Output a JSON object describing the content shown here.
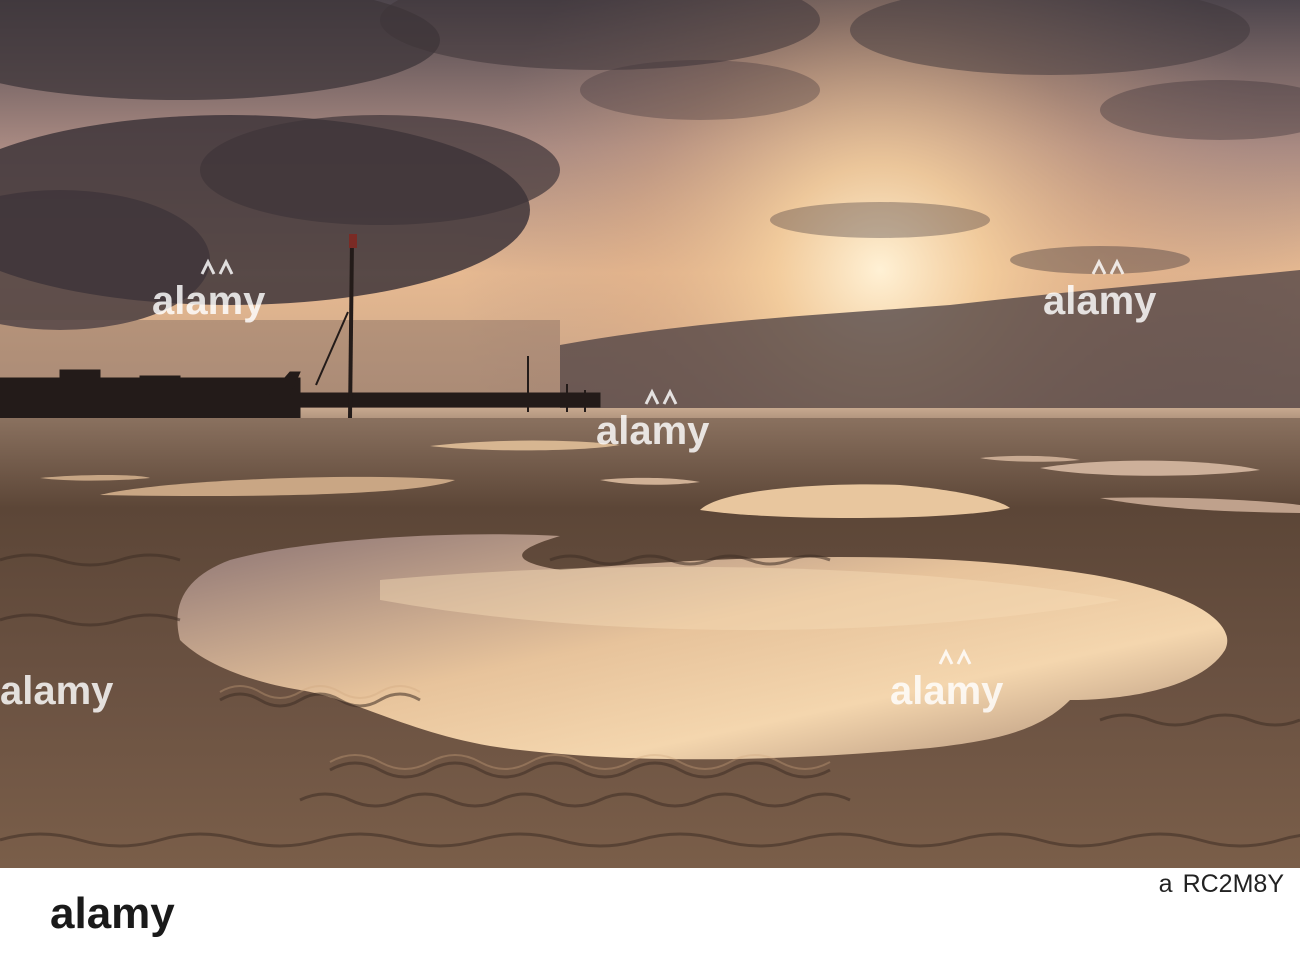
{
  "photo": {
    "subject": "beach at low tide at sunset",
    "colors": {
      "sky_top": "#5a4f55",
      "sky_glow": "#f2c99a",
      "sun": "#fff0d2",
      "cloud_dark": "#3c3438",
      "sea": "#b89a83",
      "sand": "#6b5446",
      "pool_highlight": "#f0c99d"
    }
  },
  "watermark": {
    "text": "alamy",
    "icon": "alamy-logo-icon"
  },
  "footer": {
    "logo_text": "alamy",
    "id_label": "a",
    "image_id": "RC2M8Y"
  }
}
